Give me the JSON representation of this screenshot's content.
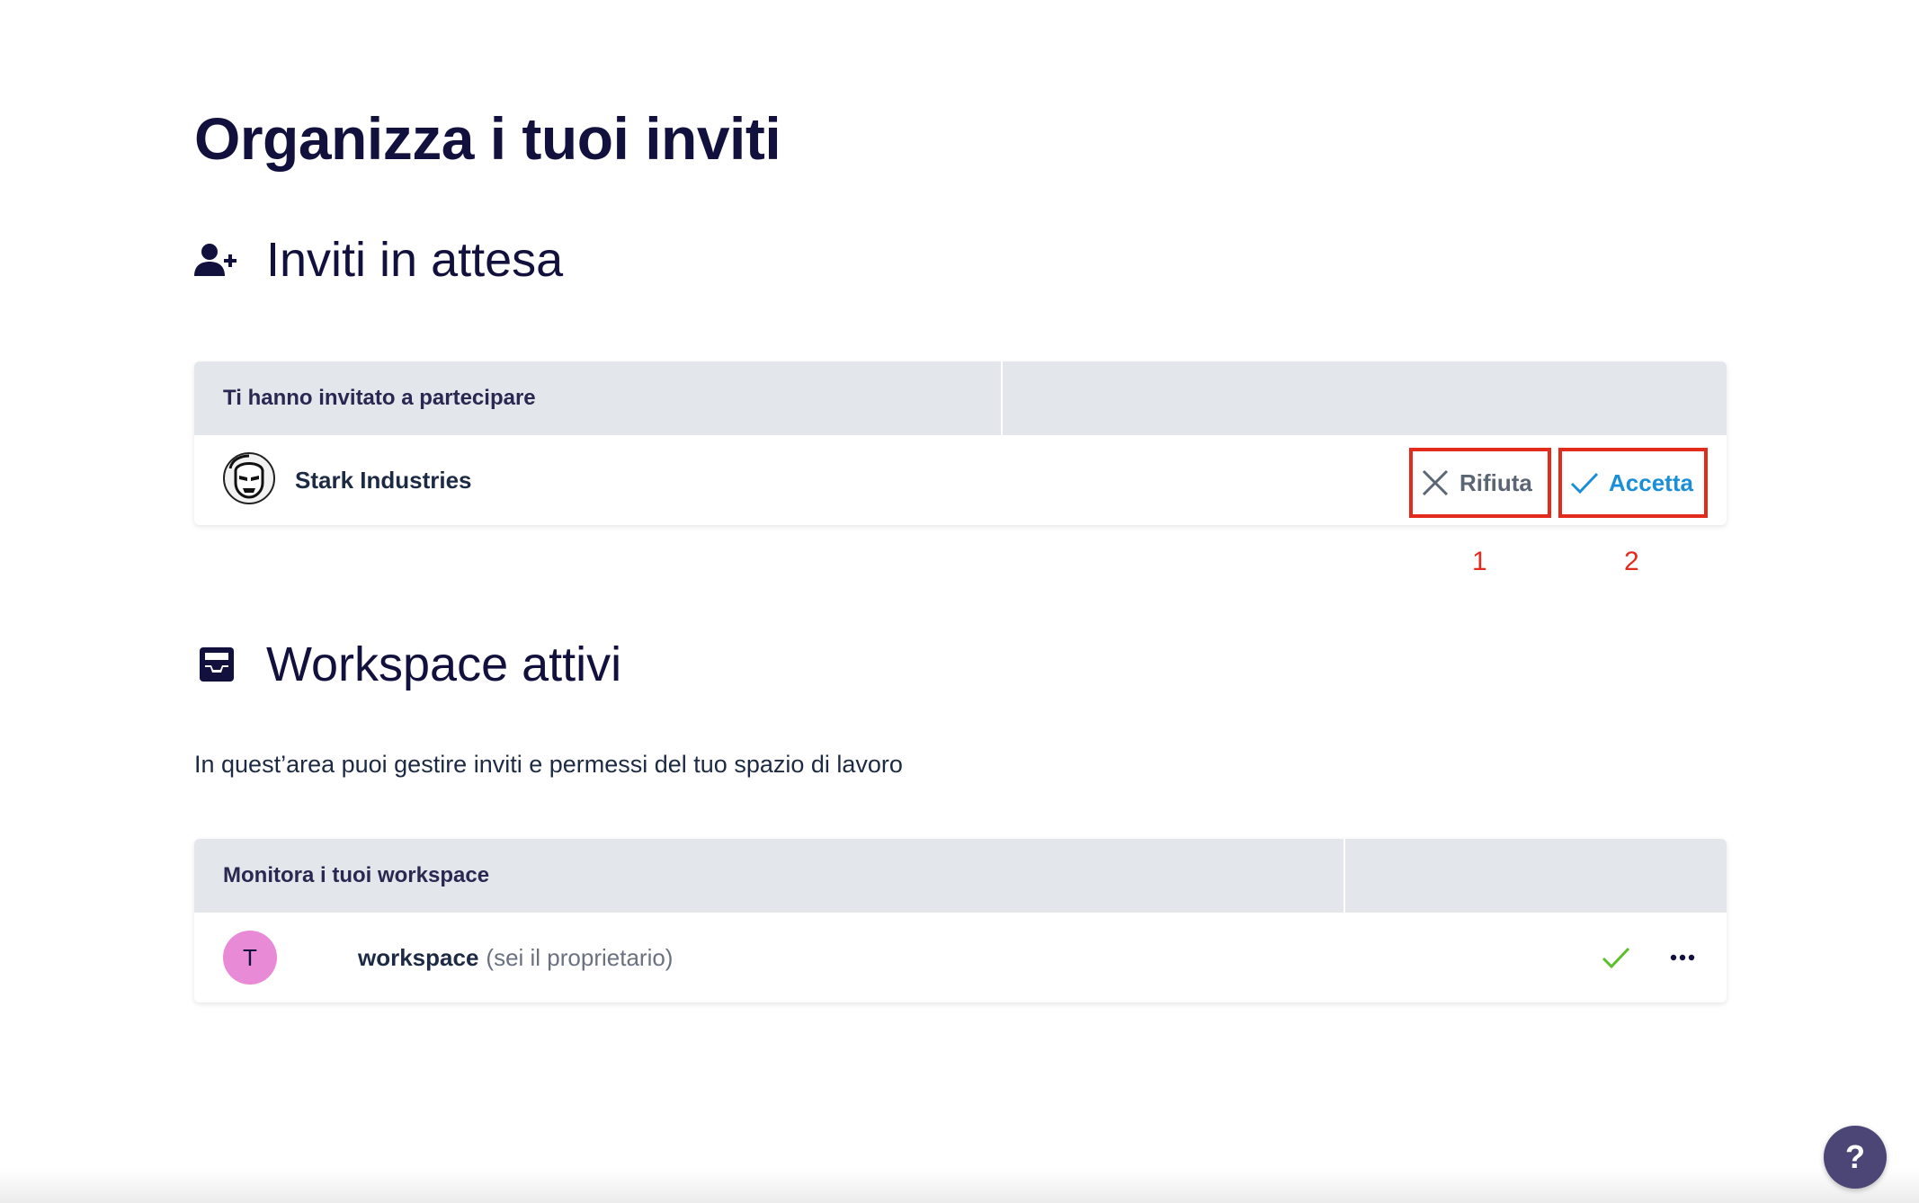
{
  "page": {
    "title": "Organizza i tuoi inviti"
  },
  "pending": {
    "heading": "Inviti in attesa",
    "icon": "user-plus-icon",
    "table_header": "Ti hanno invitato a partecipare",
    "rows": [
      {
        "org_name": "Stark Industries",
        "reject_label": "Rifiuta",
        "accept_label": "Accetta"
      }
    ],
    "markers": [
      "1",
      "2"
    ]
  },
  "active": {
    "heading": "Workspace attivi",
    "icon": "inbox-icon",
    "description": "In quest’area puoi gestire inviti e permessi del tuo spazio di lavoro",
    "table_header": "Monitora i tuoi workspace",
    "rows": [
      {
        "avatar_letter": "T",
        "avatar_color": "#e98ad6",
        "name": "workspace",
        "owner_note": "(sei il proprietario)"
      }
    ]
  },
  "help": {
    "label": "?"
  },
  "colors": {
    "primary_text": "#12113d",
    "accept": "#1a8fd8",
    "reject": "#5b6573",
    "highlight": "#e22a1d",
    "check": "#5cbf2a",
    "header_bg": "#e3e6eb"
  }
}
